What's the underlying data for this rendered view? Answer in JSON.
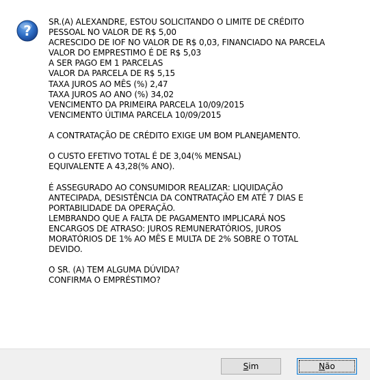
{
  "dialog": {
    "icon": "question-icon",
    "message_lines": [
      "SR.(A) ALEXANDRE, ESTOU SOLICITANDO O LIMITE DE CRÉDITO",
      "PESSOAL NO VALOR DE R$ 5,00",
      "ACRESCIDO DE IOF NO VALOR DE R$ 0,03, FINANCIADO NA PARCELA",
      "VALOR DO EMPRESTIMO É DE R$ 5,03",
      "A SER PAGO EM 1 PARCELAS",
      "VALOR DA PARCELA DE R$ 5,15",
      "TAXA JUROS AO MÊS (%) 2,47",
      "TAXA JUROS AO ANO (%) 34,02",
      "VENCIMENTO DA PRIMEIRA PARCELA 10/09/2015",
      "VENCIMENTO ÚLTIMA PARCELA 10/09/2015",
      "",
      "A CONTRATAÇÃO DE CRÉDITO EXIGE UM BOM PLANEJAMENTO.",
      "",
      "O CUSTO EFETIVO TOTAL É DE 3,04(% MENSAL)",
      "EQUIVALENTE A 43,28(% ANO).",
      "",
      "É ASSEGURADO AO CONSUMIDOR REALIZAR: LIQUIDAÇÃO",
      "ANTECIPADA, DESISTÊNCIA DA CONTRATAÇÃO EM ATÉ 7 DIAS E",
      "PORTABILIDADE DA OPERAÇÃO.",
      "LEMBRANDO QUE A FALTA DE PAGAMENTO IMPLICARÁ NOS",
      "ENCARGOS DE ATRASO: JUROS REMUNERATÓRIOS, JUROS",
      "MORATÓRIOS DE 1% AO MÊS E MULTA DE 2% SOBRE O TOTAL",
      "DEVIDO.",
      "",
      "O SR. (A) TEM ALGUMA DÚVIDA?",
      "CONFIRMA O EMPRÉSTIMO?"
    ],
    "buttons": {
      "yes": {
        "mnemonic": "S",
        "rest": "im"
      },
      "no": {
        "mnemonic": "N",
        "rest": "ão"
      }
    }
  },
  "colors": {
    "icon_blue": "#1e5fb4",
    "footer_bg": "#f0f0f0",
    "button_bg": "#e1e1e1",
    "focus_border": "#0078d7"
  }
}
